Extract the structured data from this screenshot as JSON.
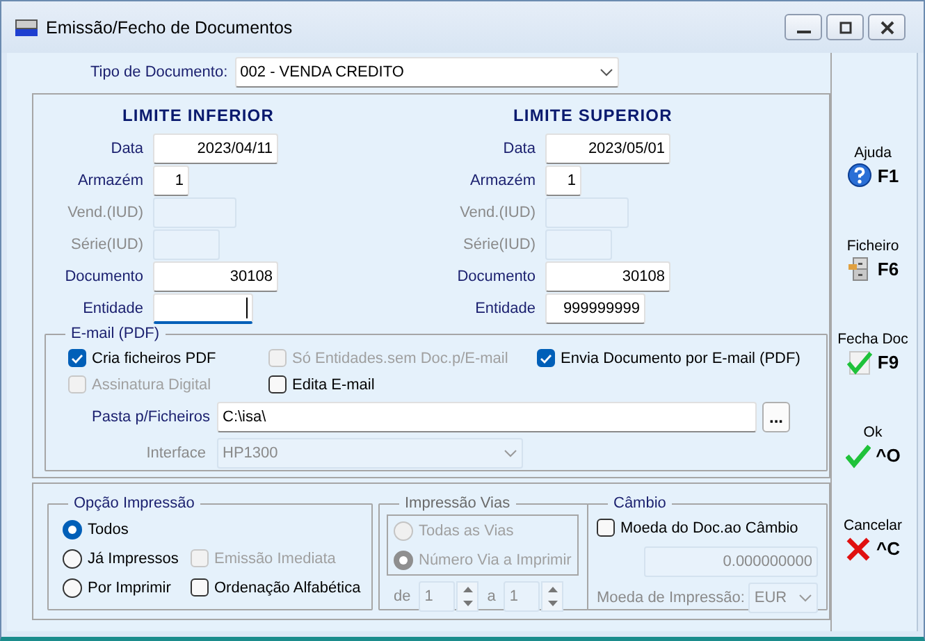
{
  "window": {
    "title": "Emissão/Fecho de Documentos"
  },
  "document_type": {
    "label": "Tipo de Documento:",
    "value": "002 - VENDA CREDITO"
  },
  "limits": [
    {
      "heading": "LIMITE INFERIOR",
      "fields": [
        {
          "label": "Data",
          "value": "2023/04/11",
          "disabled": false,
          "focused": false
        },
        {
          "label": "Armazém",
          "value": "1",
          "disabled": false,
          "focused": false
        },
        {
          "label": "Vend.(IUD)",
          "disabled": true,
          "focused": false
        },
        {
          "label": "Série(IUD)",
          "disabled": true,
          "focused": false
        },
        {
          "label": "Documento",
          "value": "30108",
          "disabled": false,
          "focused": false
        },
        {
          "label": "Entidade",
          "disabled": false,
          "focused": true
        }
      ]
    },
    {
      "heading": "LIMITE SUPERIOR",
      "fields": [
        {
          "label": "Data",
          "value": "2023/05/01",
          "disabled": false,
          "focused": false
        },
        {
          "label": "Armazém",
          "value": "1",
          "disabled": false,
          "focused": false
        },
        {
          "label": "Vend.(IUD)",
          "disabled": true,
          "focused": false
        },
        {
          "label": "Série(IUD)",
          "disabled": true,
          "focused": false
        },
        {
          "label": "Documento",
          "value": "30108",
          "disabled": false,
          "focused": false
        },
        {
          "label": "Entidade",
          "value": "999999999",
          "disabled": false,
          "focused": false
        }
      ]
    }
  ],
  "email": {
    "title": "E-mail (PDF)",
    "options": [
      {
        "label": "Cria ficheiros PDF",
        "checked": true,
        "disabled": false
      },
      {
        "label": "Só Entidades.sem Doc.p/E-mail",
        "checked": false,
        "disabled": true
      },
      {
        "label": "Envia Documento por E-mail (PDF)",
        "checked": true,
        "disabled": false
      },
      {
        "label": "Assinatura Digital",
        "checked": false,
        "disabled": true
      },
      {
        "label": "Edita E-mail",
        "checked": false,
        "disabled": false
      }
    ],
    "folder": {
      "label": "Pasta p/Ficheiros",
      "value": "C:\\isa\\",
      "button": "..."
    },
    "interface": {
      "label": "Interface",
      "value": "HP1300",
      "disabled": true
    }
  },
  "print_option": {
    "title": "Opção Impressão",
    "choices": [
      {
        "label": "Todos",
        "selected": true
      },
      {
        "label": "Já Impressos",
        "selected": false
      },
      {
        "label": "Por Imprimir",
        "selected": false
      }
    ],
    "options": [
      {
        "label": "Emissão Imediata",
        "checked": false,
        "disabled": true
      },
      {
        "label": "Ordenação Alfabética",
        "checked": false,
        "disabled": false
      }
    ]
  },
  "copies": {
    "title": "Impressão Vias",
    "disabled": true,
    "choices": [
      {
        "label": "Todas as Vias",
        "selected": false
      },
      {
        "label": "Número Via a Imprimir",
        "selected": true
      }
    ],
    "from": {
      "label": "de",
      "value": "1"
    },
    "to": {
      "label": "a",
      "value": "1"
    }
  },
  "exchange": {
    "title": "Câmbio",
    "option": {
      "label": "Moeda do Doc.ao Câmbio",
      "checked": false,
      "disabled": false
    },
    "rate": {
      "value": "0.000000000",
      "disabled": true
    },
    "currency": {
      "label": "Moeda de Impressão:",
      "value": "EUR",
      "disabled": true
    }
  },
  "toolbar": [
    {
      "label": "Ajuda",
      "key": "F1",
      "kind": "help"
    },
    {
      "label": "Ficheiro",
      "key": "F6",
      "kind": "cabinet"
    },
    {
      "label": "Fecha Doc",
      "key": "F9",
      "kind": "doc-check"
    },
    {
      "label": "Ok",
      "key": "^O",
      "kind": "check"
    },
    {
      "label": "Cancelar",
      "key": "^C",
      "kind": "cross"
    }
  ]
}
